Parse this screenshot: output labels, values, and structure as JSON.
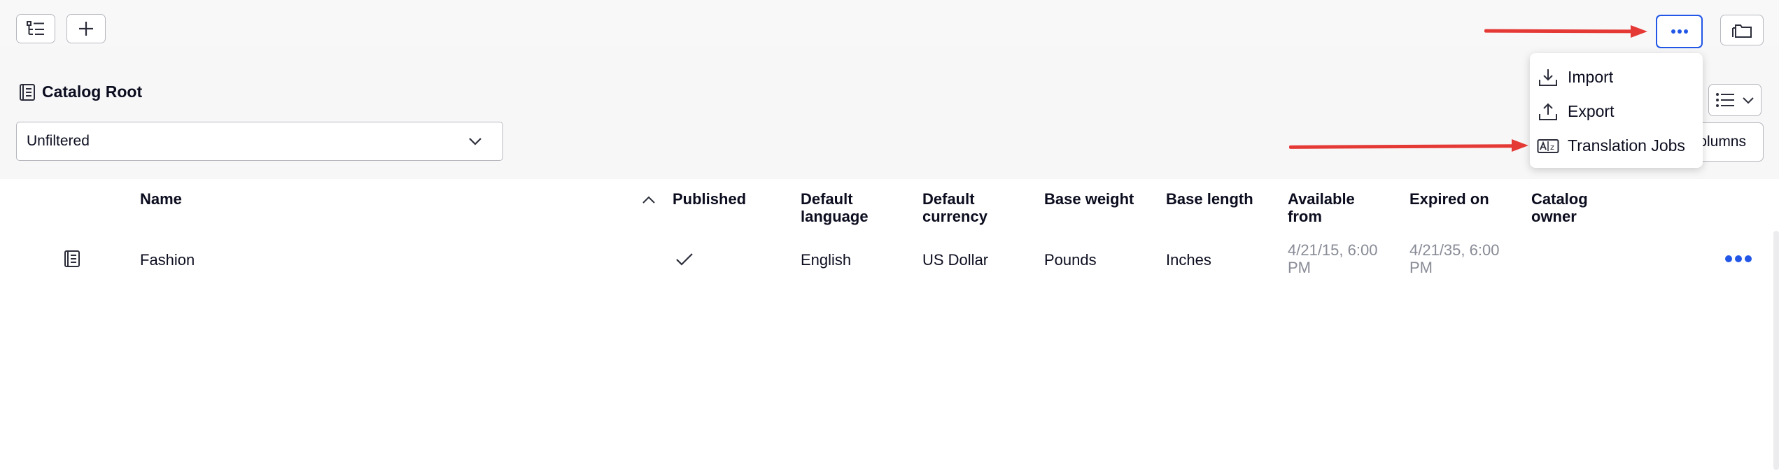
{
  "toolbar": {
    "tree_button_icon": "tree-view-icon",
    "add_button_icon": "plus-icon",
    "more_button_icon": "ellipsis-icon",
    "folder_button_icon": "folders-icon"
  },
  "catalog": {
    "title": "Catalog Root",
    "icon": "catalog-book-icon"
  },
  "filter": {
    "value": "Unfiltered"
  },
  "view_toggle": {
    "icon": "list-view-icon"
  },
  "columns_button": {
    "label": "Columns"
  },
  "menu": {
    "items": [
      {
        "label": "Import",
        "icon": "import-icon"
      },
      {
        "label": "Export",
        "icon": "export-icon"
      },
      {
        "label": "Translation Jobs",
        "icon": "translation-icon"
      }
    ]
  },
  "table": {
    "headers": {
      "name": "Name",
      "published": "Published",
      "default_language_1": "Default",
      "default_language_2": "language",
      "default_currency_1": "Default",
      "default_currency_2": "currency",
      "base_weight": "Base weight",
      "base_length": "Base length",
      "available_from_1": "Available",
      "available_from_2": "from",
      "expired_on": "Expired on",
      "catalog_owner_1": "Catalog",
      "catalog_owner_2": "owner"
    },
    "rows": [
      {
        "name": "Fashion",
        "published": true,
        "default_language": "English",
        "default_currency": "US Dollar",
        "base_weight": "Pounds",
        "base_length": "Inches",
        "available_from_1": "4/21/15, 6:00",
        "available_from_2": "PM",
        "expired_on_1": "4/21/35, 6:00",
        "expired_on_2": "PM",
        "catalog_owner": ""
      }
    ]
  },
  "colors": {
    "accent": "#2156e6",
    "annotation_arrow": "#e53935",
    "muted_text": "#888b96"
  }
}
